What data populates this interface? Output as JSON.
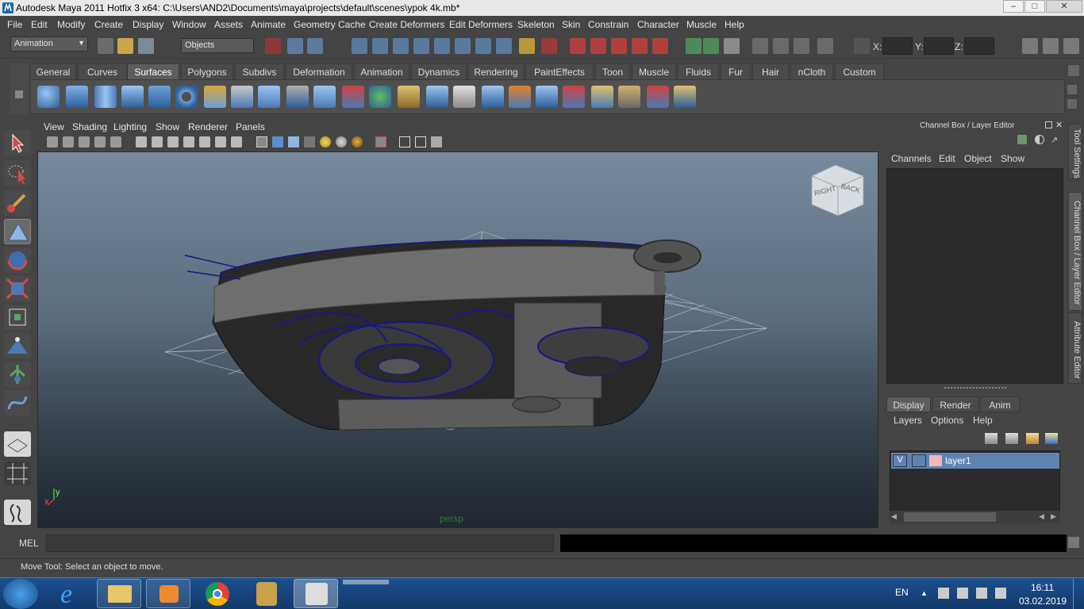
{
  "window": {
    "title": "Autodesk Maya 2011 Hotfix 3 x64: C:\\Users\\AND2\\Documents\\maya\\projects\\default\\scenes\\ypok 4k.mb*"
  },
  "menu": [
    "File",
    "Edit",
    "Modify",
    "Create",
    "Display",
    "Window",
    "Assets",
    "Animate",
    "Geometry Cache",
    "Create Deformers",
    "Edit Deformers",
    "Skeleton",
    "Skin",
    "Constrain",
    "Character",
    "Muscle",
    "Help"
  ],
  "status_line": {
    "menu_set": "Animation",
    "selection_mode": "Objects",
    "x_label": "X:",
    "y_label": "Y:",
    "z_label": "Z:",
    "x_value": "",
    "y_value": "",
    "z_value": ""
  },
  "shelf_tabs": [
    "General",
    "Curves",
    "Surfaces",
    "Polygons",
    "Subdivs",
    "Deformation",
    "Animation",
    "Dynamics",
    "Rendering",
    "PaintEffects",
    "Toon",
    "Muscle",
    "Fluids",
    "Fur",
    "Hair",
    "nCloth",
    "Custom"
  ],
  "active_shelf_tab": "Surfaces",
  "viewport": {
    "menu": [
      "View",
      "Shading",
      "Lighting",
      "Show",
      "Renderer",
      "Panels"
    ],
    "camera_label": "persp",
    "viewcube": {
      "right": "RIGHT",
      "back": "BACK"
    },
    "axis": {
      "x": "x",
      "y": "y"
    }
  },
  "channel_box": {
    "title": "Channel Box / Layer Editor",
    "menu": [
      "Channels",
      "Edit",
      "Object",
      "Show"
    ]
  },
  "layer_editor": {
    "tabs": [
      "Display",
      "Render",
      "Anim"
    ],
    "active_tab": "Display",
    "menu": [
      "Layers",
      "Options",
      "Help"
    ],
    "layers": [
      {
        "visible": "V",
        "name": "layer1",
        "color": "#f4b6b6"
      }
    ]
  },
  "side_tabs": [
    "Tool Settings",
    "Channel Box / Layer Editor",
    "Attribute Editor"
  ],
  "command_line": {
    "label": "MEL",
    "value": ""
  },
  "help_line": "Move Tool: Select an object to move.",
  "taskbar": {
    "language": "EN",
    "time": "16:11",
    "date": "03.02.2019"
  },
  "colors": {
    "accent_blue": "#6b91bf",
    "layer_selected": "#5f84b4",
    "curve": "#1a1a80"
  }
}
